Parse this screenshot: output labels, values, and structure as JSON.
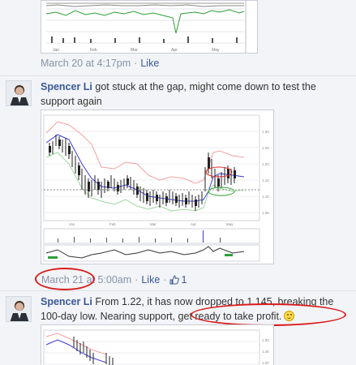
{
  "posts": [
    {
      "timestamp": "March 20 at 4:17pm",
      "like_label": "Like",
      "separator": "·"
    },
    {
      "author": "Spencer Li",
      "text": "got stuck at the gap, might come down to test the support again",
      "timestamp": "March 21 at 5:00am",
      "like_label": "Like",
      "separator": "·",
      "like_count": "1"
    },
    {
      "author": "Spencer Li",
      "text_before": "From 1.22, it has now dropped to 1.145, breaking the 100-day low. Nearing support, ",
      "text_highlight": "get ready to take profit.",
      "smiley_icon": "smiley-icon"
    }
  ],
  "colors": {
    "link": "#3b5998",
    "meta": "#8a93a6",
    "annotation": "#d91c1c",
    "background": "#f2f4f7"
  }
}
